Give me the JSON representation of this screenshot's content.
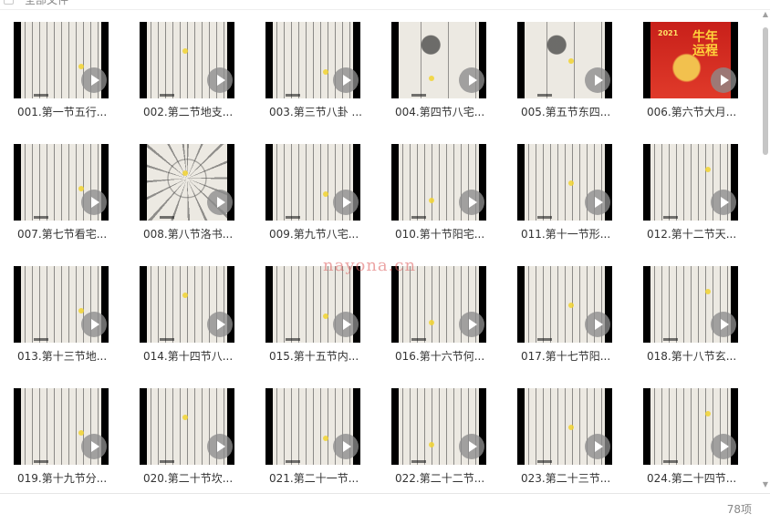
{
  "header": {
    "select_all_label": "全部文件"
  },
  "files": [
    {
      "name": "001.第一节五行...",
      "thumb": "text"
    },
    {
      "name": "002.第二节地支...",
      "thumb": "text"
    },
    {
      "name": "003.第三节八卦 ...",
      "thumb": "text"
    },
    {
      "name": "004.第四节八宅...",
      "thumb": "sparse"
    },
    {
      "name": "005.第五节东四...",
      "thumb": "sparse"
    },
    {
      "name": "006.第六节大月...",
      "thumb": "cover",
      "cover_year": "2021",
      "cover_title": "牛年运程"
    },
    {
      "name": "007.第七节看宅...",
      "thumb": "text"
    },
    {
      "name": "008.第八节洛书...",
      "thumb": "diagram"
    },
    {
      "name": "009.第九节八宅...",
      "thumb": "text"
    },
    {
      "name": "010.第十节阳宅...",
      "thumb": "text"
    },
    {
      "name": "011.第十一节形...",
      "thumb": "text"
    },
    {
      "name": "012.第十二节天...",
      "thumb": "text"
    },
    {
      "name": "013.第十三节地...",
      "thumb": "text"
    },
    {
      "name": "014.第十四节八...",
      "thumb": "text"
    },
    {
      "name": "015.第十五节内...",
      "thumb": "text"
    },
    {
      "name": "016.第十六节何...",
      "thumb": "text"
    },
    {
      "name": "017.第十七节阳...",
      "thumb": "text"
    },
    {
      "name": "018.第十八节玄...",
      "thumb": "text"
    },
    {
      "name": "019.第十九节分...",
      "thumb": "text"
    },
    {
      "name": "020.第二十节坎...",
      "thumb": "text"
    },
    {
      "name": "021.第二十一节...",
      "thumb": "text"
    },
    {
      "name": "022.第二十二节...",
      "thumb": "text"
    },
    {
      "name": "023.第二十三节...",
      "thumb": "text"
    },
    {
      "name": "024.第二十四节...",
      "thumb": "text"
    }
  ],
  "watermark": "nayona.cn",
  "footer": {
    "item_count": "78项"
  },
  "icons": {
    "file_overlay": "play-icon",
    "select_all": "checkbox-icon"
  },
  "colors": {
    "highlight": "#f2d330",
    "watermark": "#dc5a5a",
    "play_overlay": "#8c8c8c"
  }
}
